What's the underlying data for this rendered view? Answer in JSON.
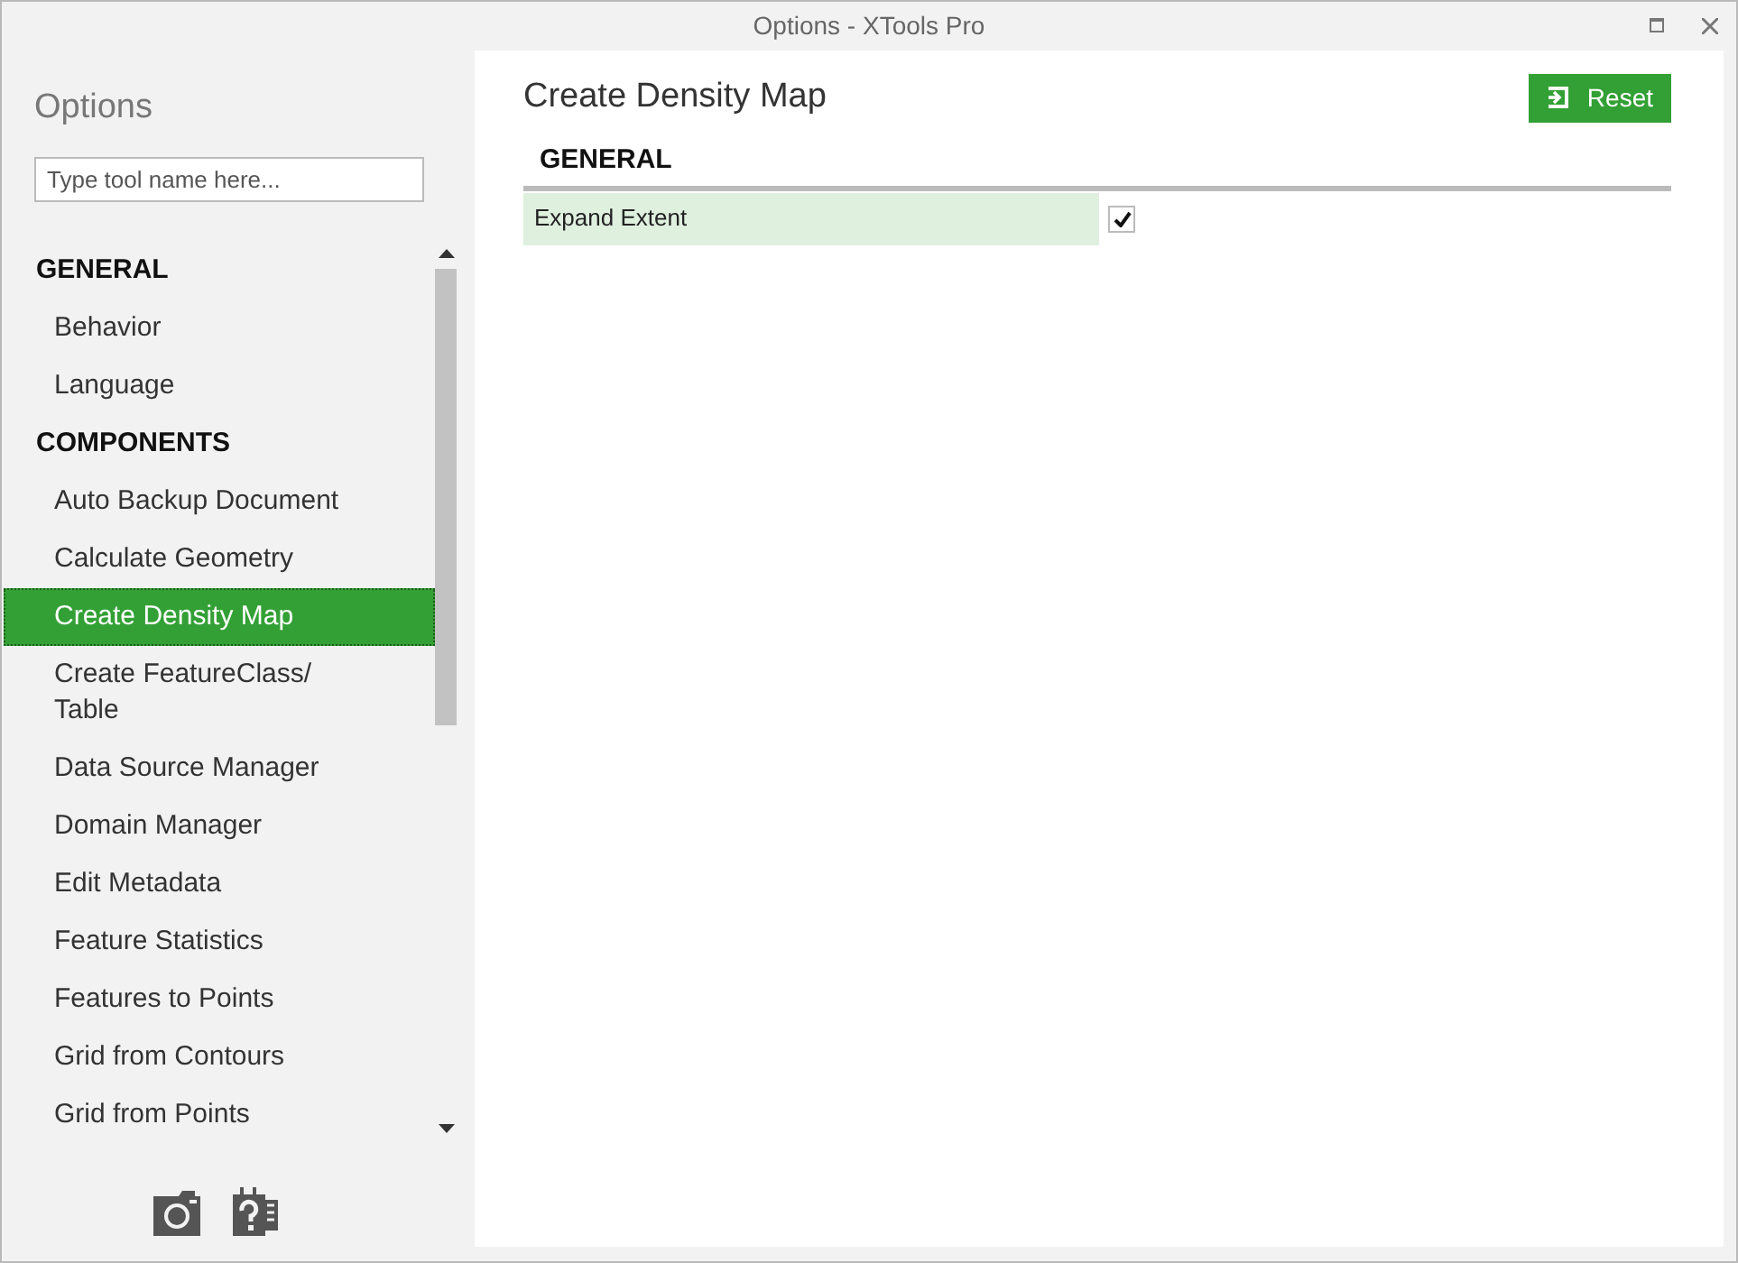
{
  "window": {
    "title": "Options - XTools Pro"
  },
  "sidebar": {
    "title": "Options",
    "search": {
      "placeholder": "Type tool name here..."
    },
    "groups": [
      {
        "heading": "GENERAL",
        "items": [
          {
            "label": "Behavior",
            "selected": false
          },
          {
            "label": "Language",
            "selected": false
          }
        ]
      },
      {
        "heading": "COMPONENTS",
        "items": [
          {
            "label": "Auto Backup Document",
            "selected": false
          },
          {
            "label": "Calculate Geometry",
            "selected": false
          },
          {
            "label": "Create Density Map",
            "selected": true
          },
          {
            "label": "Create FeatureClass/ Table",
            "selected": false
          },
          {
            "label": "Data Source Manager",
            "selected": false
          },
          {
            "label": "Domain Manager",
            "selected": false
          },
          {
            "label": "Edit Metadata",
            "selected": false
          },
          {
            "label": "Feature Statistics",
            "selected": false
          },
          {
            "label": "Features to Points",
            "selected": false
          },
          {
            "label": "Grid from Contours",
            "selected": false
          },
          {
            "label": "Grid from Points",
            "selected": false
          }
        ]
      }
    ]
  },
  "content": {
    "title": "Create Density Map",
    "reset_button": "Reset",
    "sections": [
      {
        "heading": "GENERAL",
        "settings": [
          {
            "label": "Expand Extent",
            "checked": true
          }
        ]
      }
    ]
  }
}
